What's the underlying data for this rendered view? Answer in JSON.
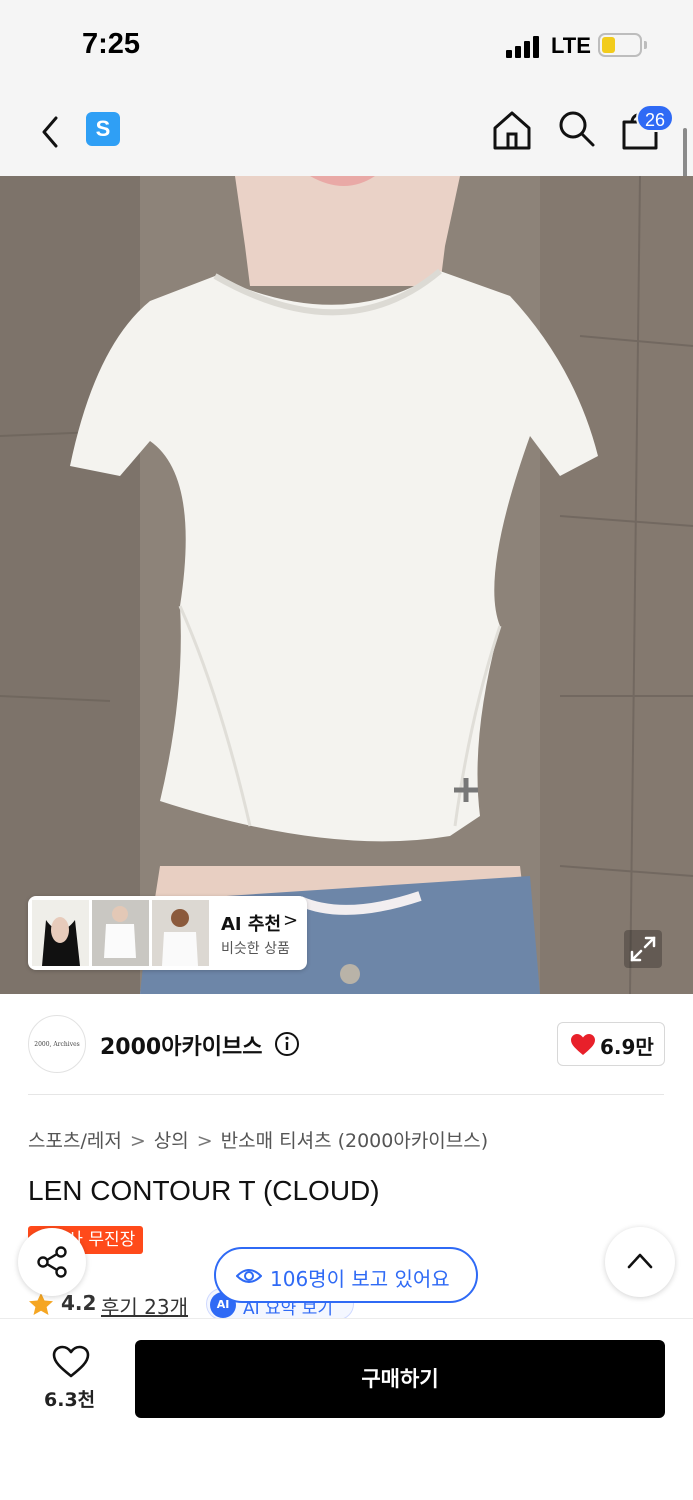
{
  "status_bar": {
    "time": "7:25",
    "network": "LTE",
    "battery_level": 0.35
  },
  "nav": {
    "logo_letter": "S",
    "cart_count": "26"
  },
  "ai_recommendation": {
    "title": "AI 추천",
    "chevron": ">",
    "subtitle": "비슷한 상품"
  },
  "brand": {
    "name": "2000아카이브스",
    "avatar_text": "2000, Archives",
    "like_count": "6.9만"
  },
  "breadcrumb": [
    "스포츠/레저",
    "상의",
    "반소매 티셔츠 (2000아카이브스)"
  ],
  "breadcrumb_sep": ">",
  "product": {
    "title": "LEN CONTOUR T (CLOUD)",
    "promo_badge": "무신사 무진장"
  },
  "viewers": {
    "text": "106명이 보고 있어요"
  },
  "rating": {
    "value": "4.2",
    "review_label": "후기 23개",
    "ai_summary_mark": "AI",
    "ai_summary": "AI 요약 보기"
  },
  "bottom": {
    "wish_count": "6.3천",
    "buy_label": "구매하기"
  },
  "colors": {
    "accent_blue": "#2f6af5",
    "promo_red": "#ff4a1a",
    "heart_red": "#e8202a",
    "star_orange": "#f5a623"
  }
}
